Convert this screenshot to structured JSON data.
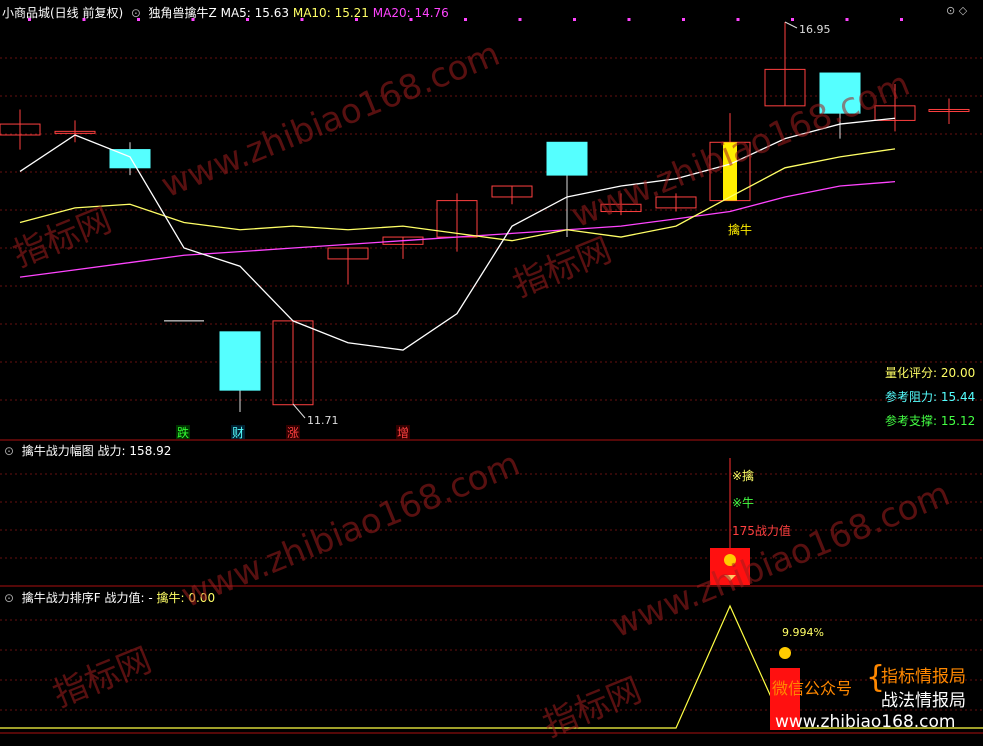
{
  "window": {
    "title": "小商品城(日线 前复权)"
  },
  "panel1": {
    "indicator": "独角兽擒牛Z",
    "ma5_label": "MA5:",
    "ma5_value": "15.63",
    "ma10_label": "MA10:",
    "ma10_value": "15.21",
    "ma20_label": "MA20:",
    "ma20_value": "14.76",
    "high_label": "16.95",
    "low_label": "11.71",
    "signal_label": "擒牛",
    "markers": [
      "跌",
      "财",
      "涨",
      "增"
    ],
    "score_label": "量化评分:",
    "score_value": "20.00",
    "resist_label": "参考阻力:",
    "resist_value": "15.44",
    "support_label": "参考支撑:",
    "support_value": "15.12"
  },
  "panel2": {
    "title": "擒牛战力幅图",
    "value_label": "战力:",
    "value": "158.92",
    "tag1": "※擒",
    "tag2": "※牛",
    "tag3": "175战力值"
  },
  "panel3": {
    "title": "擒牛战力排序F",
    "label1": "战力值:",
    "value1": "-",
    "label2": "擒牛:",
    "value2": "0.00",
    "pct_label": "9.994%",
    "promo_label": "微信公众号",
    "promo_line1": "指标情报局",
    "promo_line2": "战法情报局",
    "promo_url": "www.zhibiao168.com"
  },
  "watermark": {
    "text": "www.zhibiao168.com",
    "cn_text": "指标网"
  },
  "colors": {
    "up": "#ff4040",
    "down": "#55ffff",
    "ma5": "#ffffff",
    "ma10": "#ffff66",
    "ma20": "#ff44ff",
    "grid": "#661010",
    "signal": "#ffee00",
    "promo": "#ff8800"
  },
  "chart_data": {
    "type": "candlestick",
    "candles": [
      {
        "o": 15.4,
        "h": 15.75,
        "l": 15.2,
        "c": 15.55
      },
      {
        "o": 15.45,
        "h": 15.6,
        "l": 15.3,
        "c": 15.45
      },
      {
        "o": 15.2,
        "h": 15.3,
        "l": 14.85,
        "c": 14.95
      },
      {
        "o": null,
        "h": null,
        "l": null,
        "c": 12.85
      },
      {
        "o": 12.7,
        "h": 12.55,
        "l": 11.6,
        "c": 11.9
      },
      {
        "o": 11.7,
        "h": 12.85,
        "l": 11.71,
        "c": 12.85
      },
      {
        "o": 13.7,
        "h": 13.75,
        "l": 13.35,
        "c": 13.85
      },
      {
        "o": 13.9,
        "h": 14.0,
        "l": 13.7,
        "c": 14.0
      },
      {
        "o": 14.0,
        "h": 14.6,
        "l": 13.8,
        "c": 14.5
      },
      {
        "o": 14.55,
        "h": 14.7,
        "l": 14.45,
        "c": 14.7
      },
      {
        "o": 15.3,
        "h": 15.3,
        "l": 14.0,
        "c": 14.85
      },
      {
        "o": 14.35,
        "h": 14.6,
        "l": 14.3,
        "c": 14.45
      },
      {
        "o": 14.4,
        "h": 14.6,
        "l": 14.35,
        "c": 14.55
      },
      {
        "o": 14.5,
        "h": 15.7,
        "l": 14.5,
        "c": 15.3
      },
      {
        "o": 15.8,
        "h": 16.95,
        "l": 15.8,
        "c": 16.3
      },
      {
        "o": 16.25,
        "h": 16.25,
        "l": 15.35,
        "c": 15.7
      },
      {
        "o": 15.6,
        "h": 16.1,
        "l": 15.45,
        "c": 15.8
      },
      {
        "o": 15.75,
        "h": 15.9,
        "l": 15.55,
        "c": 15.75
      }
    ],
    "ma5": [
      14.9,
      15.4,
      15.1,
      13.85,
      13.6,
      12.85,
      12.55,
      12.45,
      12.95,
      14.15,
      14.55,
      14.7,
      14.8,
      15.0,
      15.35,
      15.55,
      15.63
    ],
    "ma10": [
      14.2,
      14.4,
      14.45,
      14.2,
      14.1,
      14.15,
      14.1,
      14.15,
      14.05,
      13.95,
      14.1,
      14.0,
      14.15,
      14.55,
      14.95,
      15.1,
      15.21
    ],
    "ma20": [
      13.45,
      13.55,
      13.65,
      13.75,
      13.8,
      13.85,
      13.9,
      13.95,
      14.0,
      14.05,
      14.1,
      14.15,
      14.25,
      14.35,
      14.55,
      14.7,
      14.76
    ],
    "power": [
      0,
      0,
      0,
      0,
      0,
      0,
      0,
      0,
      0,
      0,
      0,
      0,
      0,
      175,
      0,
      0,
      0,
      0
    ],
    "rank": [
      0,
      0,
      0,
      0,
      0,
      0,
      0,
      0,
      0,
      0,
      0,
      0,
      0,
      9.994,
      0,
      0,
      0,
      0
    ]
  }
}
